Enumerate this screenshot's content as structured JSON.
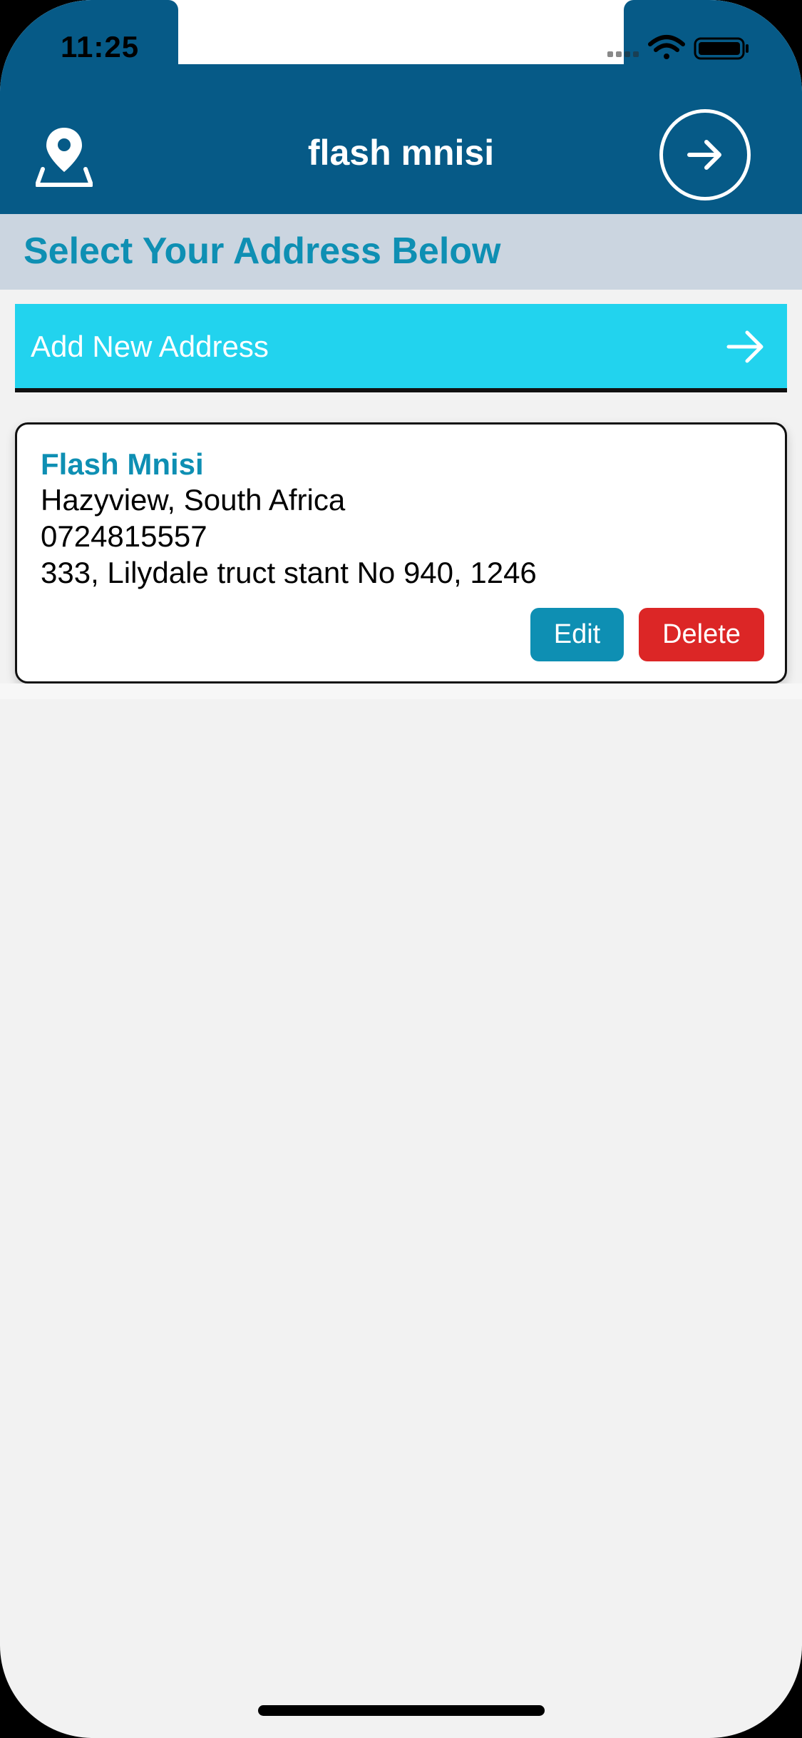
{
  "status_bar": {
    "time": "11:25",
    "icons": [
      "cellular-signal-icon",
      "wifi-icon",
      "battery-icon"
    ]
  },
  "nav": {
    "left_icon": "location-pin-icon",
    "title": "flash mnisi",
    "right_icon": "arrow-right-circle-icon"
  },
  "section": {
    "title": "Select Your Address Below"
  },
  "add_address": {
    "label": "Add New Address",
    "icon": "arrow-right-icon"
  },
  "addresses": [
    {
      "name": "Flash Mnisi",
      "city": "Hazyview, South Africa",
      "phone": "0724815557",
      "street": "333, Lilydale truct stant No 940, 1246",
      "edit_label": "Edit",
      "delete_label": "Delete"
    }
  ],
  "colors": {
    "header_blue": "#065a87",
    "accent_teal": "#0e8fb3",
    "add_button_cyan": "#22d3ee",
    "section_gray": "#cbd5e0",
    "delete_red": "#dc2626",
    "background": "#f2f2f2"
  }
}
